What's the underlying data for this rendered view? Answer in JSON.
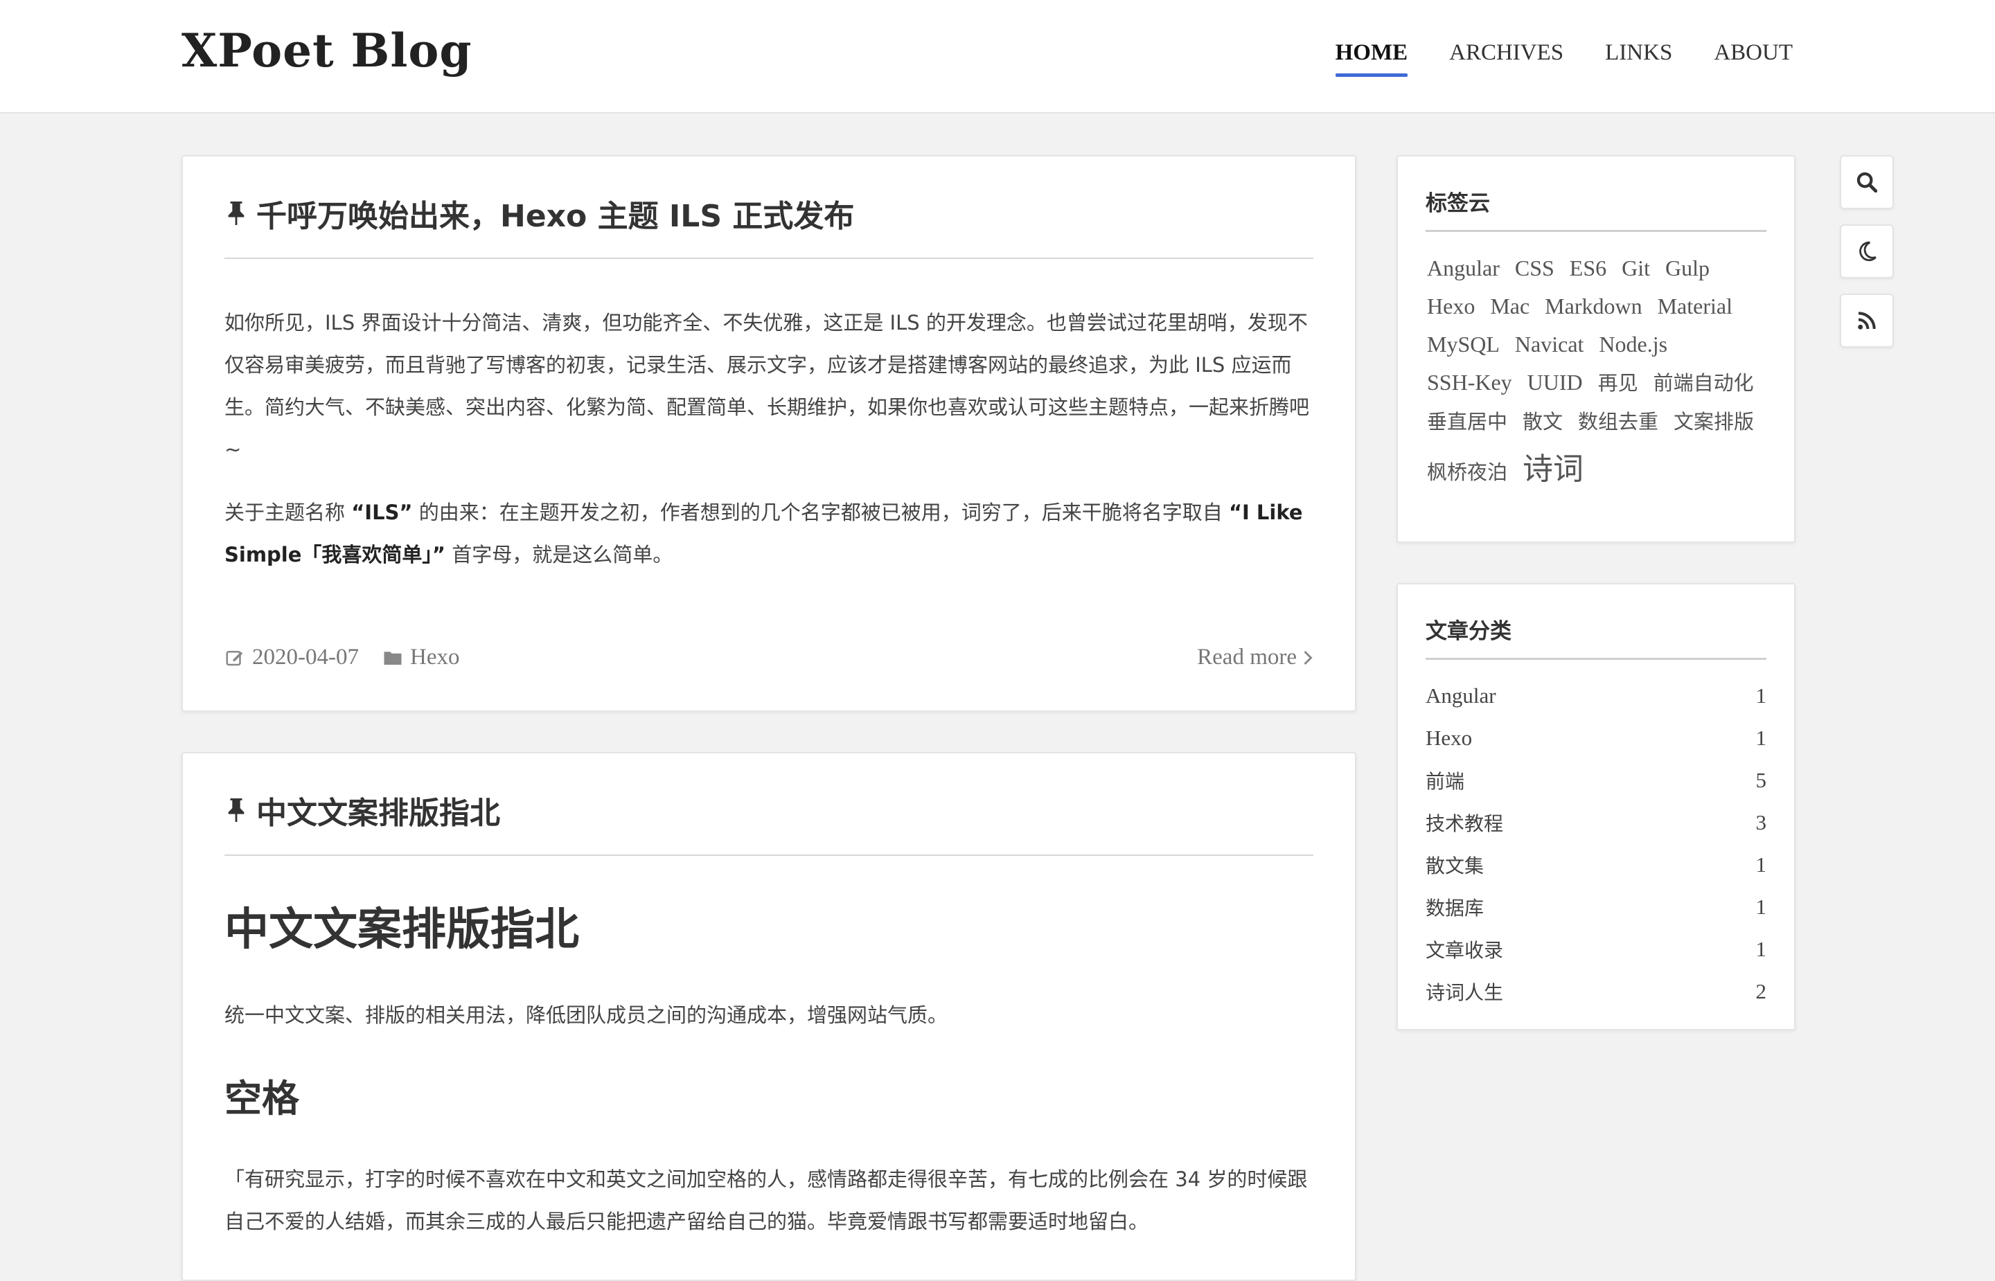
{
  "site": {
    "title": "XPoet Blog"
  },
  "nav": {
    "items": [
      {
        "label": "HOME",
        "active": true
      },
      {
        "label": "ARCHIVES",
        "active": false
      },
      {
        "label": "LINKS",
        "active": false
      },
      {
        "label": "ABOUT",
        "active": false
      }
    ]
  },
  "posts": [
    {
      "title": "千呼万唤始出来，Hexo 主题 ILS 正式发布",
      "paragraph1": "如你所见，ILS 界面设计十分简洁、清爽，但功能齐全、不失优雅，这正是 ILS 的开发理念。也曾尝试过花里胡哨，发现不仅容易审美疲劳，而且背驰了写博客的初衷，记录生活、展示文字，应该才是搭建博客网站的最终追求，为此 ILS 应运而生。简约大气、不缺美感、突出内容、化繁为简、配置简单、长期维护，如果你也喜欢或认可这些主题特点，一起来折腾吧~",
      "paragraph2_pre": "关于主题名称 ",
      "paragraph2_bold1": "“ILS”",
      "paragraph2_mid": " 的由来：在主题开发之初，作者想到的几个名字都被已被用，词穷了，后来干脆将名字取自 ",
      "paragraph2_bold2": "“I Like Simple「我喜欢简单」”",
      "paragraph2_post": " 首字母，就是这么简单。",
      "date": "2020-04-07",
      "category": "Hexo",
      "read_more": "Read more"
    },
    {
      "title": "中文文案排版指北",
      "h1": "中文文案排版指北",
      "intro": "统一中文文案、排版的相关用法，降低团队成员之间的沟通成本，增强网站气质。",
      "h2": "空格",
      "quote": "「有研究显示，打字的时候不喜欢在中文和英文之间加空格的人，感情路都走得很辛苦，有七成的比例会在 34 岁的时候跟自己不爱的人结婚，而其余三成的人最后只能把遗产留给自己的猫。毕竟爱情跟书写都需要适时地留白。"
    }
  ],
  "tagcloud": {
    "title": "标签云",
    "tags": [
      "Angular",
      "CSS",
      "ES6",
      "Git",
      "Gulp",
      "Hexo",
      "Mac",
      "Markdown",
      "Material",
      "MySQL",
      "Navicat",
      "Node.js",
      "SSH-Key",
      "UUID",
      "再见",
      "前端自动化",
      "垂直居中",
      "散文",
      "数组去重",
      "文案排版",
      "枫桥夜泊",
      "诗词"
    ]
  },
  "categories": {
    "title": "文章分类",
    "items": [
      {
        "name": "Angular",
        "count": "1"
      },
      {
        "name": "Hexo",
        "count": "1"
      },
      {
        "name": "前端",
        "count": "5"
      },
      {
        "name": "技术教程",
        "count": "3"
      },
      {
        "name": "散文集",
        "count": "1"
      },
      {
        "name": "数据库",
        "count": "1"
      },
      {
        "name": "文章收录",
        "count": "1"
      },
      {
        "name": "诗词人生",
        "count": "2"
      }
    ]
  },
  "tools": [
    "search-icon",
    "moon-icon",
    "rss-icon"
  ],
  "colors": {
    "accent": "#3d6ad6",
    "background": "#f2f2f2",
    "text": "#333333"
  }
}
